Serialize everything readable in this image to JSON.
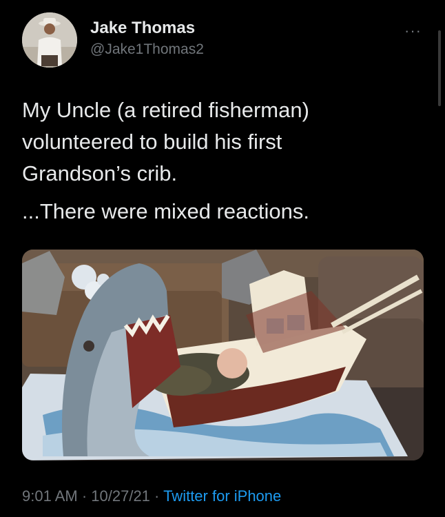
{
  "author": {
    "name": "Jake Thomas",
    "handle": "@Jake1Thomas2"
  },
  "menu": {
    "more_label": "···"
  },
  "tweet": {
    "text": "My Uncle (a retired fisherman)\nvolunteered to build his first\nGrandson’s crib.",
    "text2": "...There were mixed reactions."
  },
  "meta": {
    "time": "9:01 AM",
    "sep1": " · ",
    "date": "10/27/21",
    "sep2": " · ",
    "source": "Twitter for iPhone"
  },
  "colors": {
    "background": "#000000",
    "text": "#e7e9ea",
    "secondary": "#71767b",
    "link": "#1d9bf0"
  }
}
